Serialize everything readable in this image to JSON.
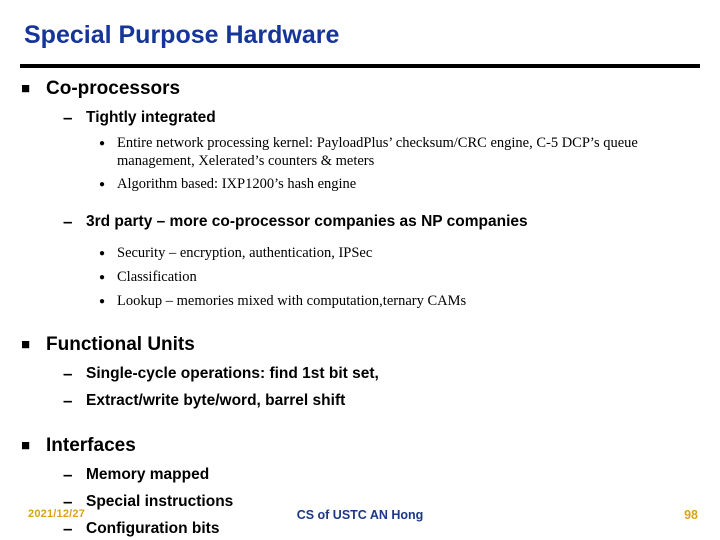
{
  "slide": {
    "title": "Special Purpose Hardware",
    "title_color": "#16359B",
    "rule_color": "#000000",
    "background": "#ffffff"
  },
  "bullets": {
    "level1_glyph": "■",
    "level2_glyph": "–",
    "level3_glyph": "●"
  },
  "content": [
    {
      "level": 1,
      "text": "Co-processors"
    },
    {
      "level": 2,
      "text": "Tightly integrated"
    },
    {
      "level": 3,
      "text": "Entire network processing kernel: PayloadPlus’ checksum/CRC engine, C-5 DCP’s queue management, Xelerated’s counters & meters"
    },
    {
      "level": 3,
      "text": "Algorithm based: IXP1200’s hash engine"
    },
    {
      "level": 2,
      "text": "3rd party – more co-processor companies as NP companies"
    },
    {
      "level": 3,
      "text": "Security – encryption, authentication, IPSec"
    },
    {
      "level": 3,
      "text": "Classification"
    },
    {
      "level": 3,
      "text": "Lookup – memories mixed with computation,ternary CAMs"
    },
    {
      "level": 1,
      "text": "Functional Units"
    },
    {
      "level": 2,
      "text": "Single-cycle operations: find 1st bit set,"
    },
    {
      "level": 2,
      "text": "Extract/write byte/word, barrel shift"
    },
    {
      "level": 1,
      "text": "Interfaces"
    },
    {
      "level": 2,
      "text": "Memory mapped"
    },
    {
      "level": 2,
      "text": "Special instructions"
    },
    {
      "level": 2,
      "text": "Configuration bits"
    }
  ],
  "footer": {
    "date": "2021/12/27",
    "date_color": "#D6A41C",
    "center": "CS of USTC AN Hong",
    "center_color": "#1C3787",
    "page": "98",
    "page_color": "#D6A41C"
  }
}
